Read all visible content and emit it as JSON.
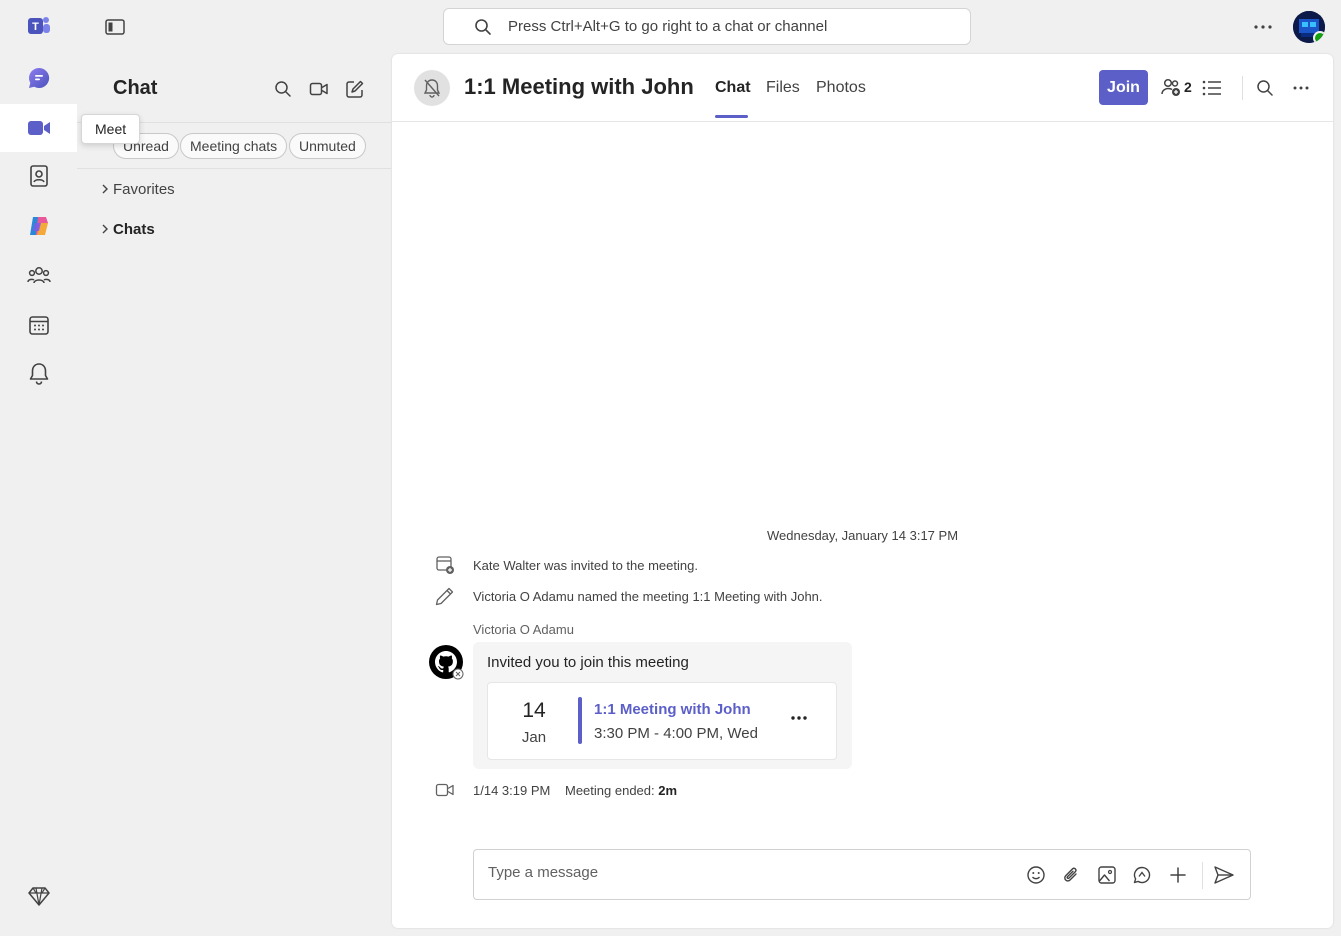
{
  "search": {
    "placeholder": "Press Ctrl+Alt+G to go right to a chat or channel"
  },
  "rail": {
    "tooltip": "Meet",
    "items": [
      {
        "icon": "teams-logo-icon"
      },
      {
        "icon": "chat-icon"
      },
      {
        "icon": "meet-icon",
        "active": true
      },
      {
        "icon": "contacts-icon"
      },
      {
        "icon": "copilot-icon"
      },
      {
        "icon": "communities-icon"
      },
      {
        "icon": "calendar-icon"
      },
      {
        "icon": "activity-bell-icon"
      },
      {
        "icon": "premium-diamond-icon"
      }
    ]
  },
  "panel": {
    "title": "Chat",
    "filters": [
      "Unread",
      "Meeting chats",
      "Unmuted"
    ],
    "tree": [
      {
        "label": "Favorites",
        "bold": false
      },
      {
        "label": "Chats",
        "bold": true
      }
    ]
  },
  "header": {
    "title": "1:1 Meeting with John",
    "tabs": [
      "Chat",
      "Files",
      "Photos"
    ],
    "active_tab": "Chat",
    "join_label": "Join",
    "participant_count": "2"
  },
  "messages": {
    "date_divider": "Wednesday, January 14 3:17 PM",
    "events": [
      "Kate Walter was invited to the meeting.",
      "Victoria O Adamu named the meeting 1:1 Meeting with John."
    ],
    "sender": "Victoria O Adamu",
    "invite_text": "Invited you to join this meeting",
    "card": {
      "day": "14",
      "month": "Jan",
      "title": "1:1 Meeting with John",
      "time": "3:30 PM - 4:00 PM, Wed"
    },
    "ended": {
      "timestamp": "1/14 3:19 PM",
      "label": "Meeting ended:",
      "duration": "2m"
    }
  },
  "compose": {
    "placeholder": "Type a message"
  },
  "colors": {
    "accent": "#5b5fc7",
    "status_available": "#13a10e"
  }
}
